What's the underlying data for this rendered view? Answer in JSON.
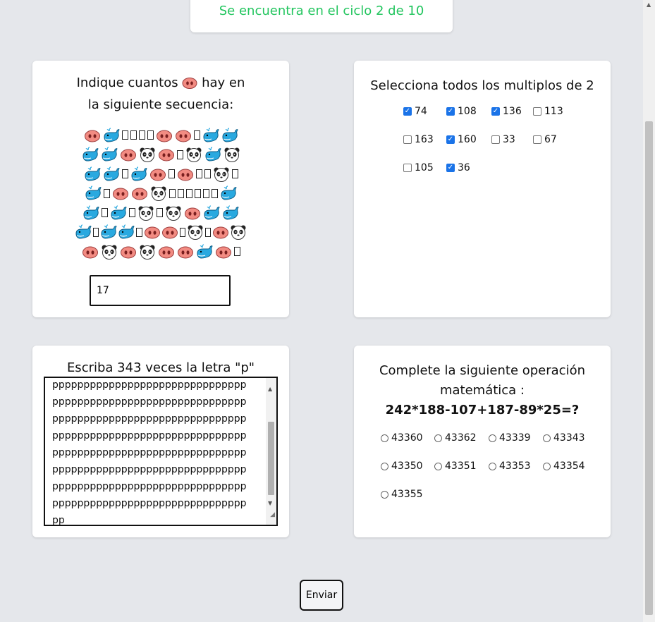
{
  "header": {
    "status": "Se encuentra en el ciclo 2 de 10"
  },
  "emoji_question": {
    "prompt_before": "Indique cuantos",
    "prompt_after": "hay en",
    "prompt_line2": "la siguiente secuencia:",
    "target_icon": "pig-nose-icon",
    "sequence": [
      [
        "nose",
        "whale",
        "box",
        "box",
        "box",
        "box",
        "nose",
        "nose",
        "box",
        "whale",
        "whale"
      ],
      [
        "whale",
        "whale",
        "nose",
        "panda",
        "nose",
        "box",
        "panda",
        "whale",
        "panda"
      ],
      [
        "whale",
        "whale",
        "box",
        "whale",
        "nose",
        "box",
        "nose",
        "box",
        "box",
        "panda",
        "box"
      ],
      [
        "whale",
        "box",
        "nose",
        "nose",
        "panda",
        "box",
        "box",
        "box",
        "box",
        "box",
        "box",
        "whale"
      ],
      [
        "whale",
        "box",
        "whale",
        "box",
        "panda",
        "box",
        "panda",
        "nose",
        "whale",
        "whale"
      ],
      [
        "whale",
        "box",
        "whale",
        "whale",
        "box",
        "nose",
        "nose",
        "box",
        "panda",
        "box",
        "nose",
        "panda"
      ],
      [
        "nose",
        "panda",
        "nose",
        "panda",
        "nose",
        "nose",
        "whale",
        "nose",
        "box"
      ]
    ],
    "answer_value": "17"
  },
  "multiples_question": {
    "title": "Selecciona todos los multiplos de 2",
    "options": [
      {
        "label": "74",
        "checked": true
      },
      {
        "label": "108",
        "checked": true
      },
      {
        "label": "136",
        "checked": true
      },
      {
        "label": "113",
        "checked": false
      },
      {
        "label": "163",
        "checked": false
      },
      {
        "label": "160",
        "checked": true
      },
      {
        "label": "33",
        "checked": false
      },
      {
        "label": "67",
        "checked": false
      },
      {
        "label": "105",
        "checked": false
      },
      {
        "label": "36",
        "checked": true
      }
    ]
  },
  "letter_question": {
    "title": "Escriba 343 veces la letra \"p\"",
    "text_lines": [
      "ppppppppppppppppppppppppppppppp",
      "ppppppppppppppppppppppppppppppp",
      "ppppppppppppppppppppppppppppppp",
      "ppppppppppppppppppppppppppppppp",
      "ppppppppppppppppppppppppppppppp",
      "ppppppppppppppppppppppppppppppp",
      "ppppppppppppppppppppppppppppppp",
      "ppppppppppppppppppppppppppppppp",
      "pp"
    ]
  },
  "math_question": {
    "line1": "Complete la siguiente operación",
    "line2": "matemática :",
    "operation": "242*188-107+187-89*25=?",
    "options": [
      "43360",
      "43362",
      "43339",
      "43343",
      "43350",
      "43351",
      "43353",
      "43354",
      "43355"
    ]
  },
  "submit": {
    "label": "Enviar"
  }
}
